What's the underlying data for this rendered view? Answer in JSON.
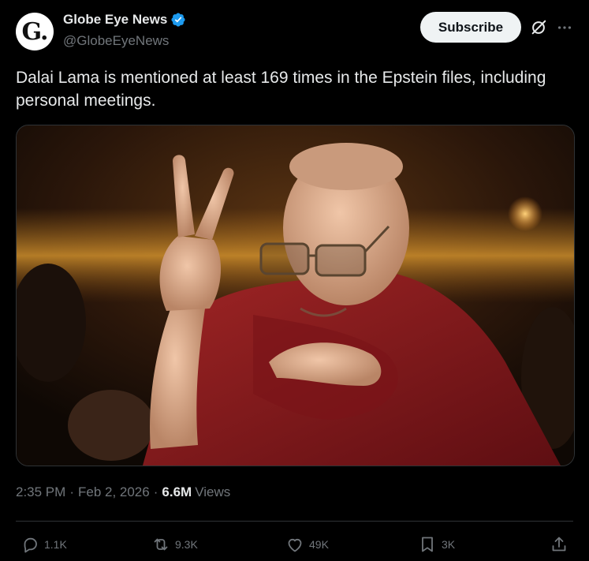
{
  "post": {
    "author_name": "Globe Eye News",
    "author_handle": "@GlobeEyeNews",
    "avatar_letter": "G.",
    "verified_icon": "verified-badge-icon",
    "subscribe_label": "Subscribe",
    "text": "Dalai Lama is mentioned at least 169 times in the Epstein files, including personal meetings.",
    "media_icon": "photo",
    "time": "2:35 PM",
    "date": "Feb 2, 2026",
    "views_count": "6.6M",
    "views_label": "Views"
  },
  "actions": {
    "replies": "1.1K",
    "reposts": "9.3K",
    "likes": "49K",
    "bookmarks": "3K"
  },
  "colors": {
    "background": "#000000",
    "text": "#e7e9ea",
    "secondary": "#71767b",
    "verified": "#1d9bf0",
    "button_bg": "#eff3f4"
  }
}
